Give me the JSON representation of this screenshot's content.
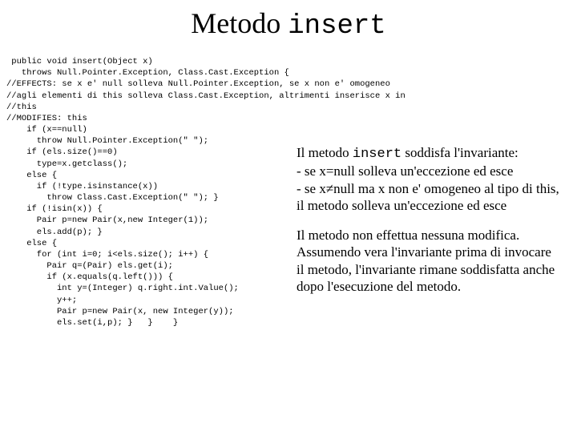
{
  "title": {
    "word": "Metodo ",
    "mono": "insert"
  },
  "code": " public void insert(Object x)\n   throws Null.Pointer.Exception, Class.Cast.Exception {\n//EFFECTS: se x e' null solleva Null.Pointer.Exception, se x non e' omogeneo\n//agli elementi di this solleva Class.Cast.Exception, altrimenti inserisce x in\n//this\n//MODIFIES: this\n    if (x==null)\n      throw Null.Pointer.Exception(\" \");\n    if (els.size()==0)\n      type=x.getclass();\n    else {\n      if (!type.isinstance(x))\n        throw Class.Cast.Exception(\" \"); }\n    if (!isin(x)) {\n      Pair p=new Pair(x,new Integer(1));\n      els.add(p); }\n    else {\n      for (int i=0; i<els.size(); i++) {\n        Pair q=(Pair) els.get(i);\n        if (x.equals(q.left())) {\n          int y=(Integer) q.right.int.Value();\n          y++;\n          Pair p=new Pair(x, new Integer(y));\n          els.set(i,p); }   }    }",
  "right": {
    "p1_a": "Il metodo ",
    "p1_mono": "insert",
    "p1_b": " soddisfa l'invariante:",
    "p1_l1": "- se x=null solleva un'eccezione ed esce",
    "p1_l2": "- se x≠null ma x non e' omogeneo al tipo di this, il metodo solleva un'eccezione ed esce",
    "p2": "Il metodo non effettua nessuna modifica. Assumendo vera l'invariante prima di invocare il metodo, l'invariante rimane soddisfatta anche dopo l'esecuzione del metodo."
  }
}
